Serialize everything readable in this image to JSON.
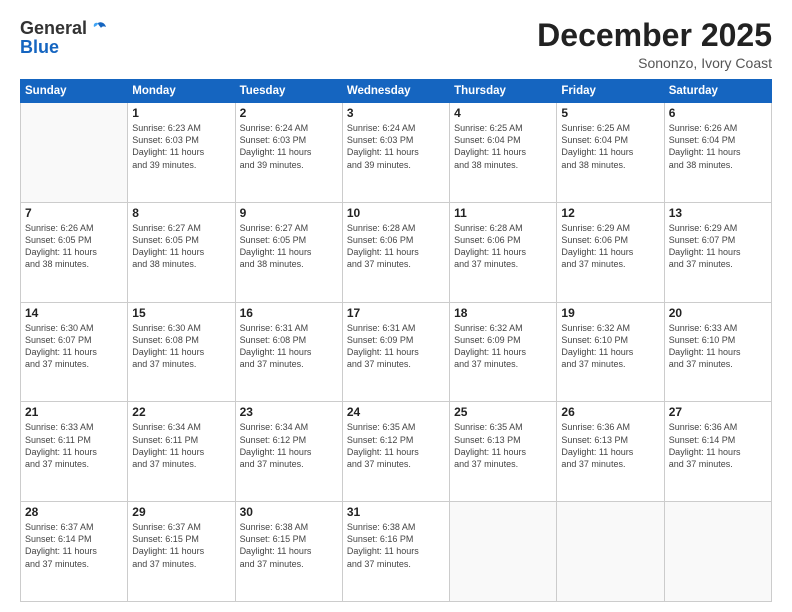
{
  "header": {
    "logo_general": "General",
    "logo_blue": "Blue",
    "month": "December 2025",
    "location": "Sononzo, Ivory Coast"
  },
  "weekdays": [
    "Sunday",
    "Monday",
    "Tuesday",
    "Wednesday",
    "Thursday",
    "Friday",
    "Saturday"
  ],
  "weeks": [
    [
      {
        "day": "",
        "info": ""
      },
      {
        "day": "1",
        "info": "Sunrise: 6:23 AM\nSunset: 6:03 PM\nDaylight: 11 hours\nand 39 minutes."
      },
      {
        "day": "2",
        "info": "Sunrise: 6:24 AM\nSunset: 6:03 PM\nDaylight: 11 hours\nand 39 minutes."
      },
      {
        "day": "3",
        "info": "Sunrise: 6:24 AM\nSunset: 6:03 PM\nDaylight: 11 hours\nand 39 minutes."
      },
      {
        "day": "4",
        "info": "Sunrise: 6:25 AM\nSunset: 6:04 PM\nDaylight: 11 hours\nand 38 minutes."
      },
      {
        "day": "5",
        "info": "Sunrise: 6:25 AM\nSunset: 6:04 PM\nDaylight: 11 hours\nand 38 minutes."
      },
      {
        "day": "6",
        "info": "Sunrise: 6:26 AM\nSunset: 6:04 PM\nDaylight: 11 hours\nand 38 minutes."
      }
    ],
    [
      {
        "day": "7",
        "info": "Sunrise: 6:26 AM\nSunset: 6:05 PM\nDaylight: 11 hours\nand 38 minutes."
      },
      {
        "day": "8",
        "info": "Sunrise: 6:27 AM\nSunset: 6:05 PM\nDaylight: 11 hours\nand 38 minutes."
      },
      {
        "day": "9",
        "info": "Sunrise: 6:27 AM\nSunset: 6:05 PM\nDaylight: 11 hours\nand 38 minutes."
      },
      {
        "day": "10",
        "info": "Sunrise: 6:28 AM\nSunset: 6:06 PM\nDaylight: 11 hours\nand 37 minutes."
      },
      {
        "day": "11",
        "info": "Sunrise: 6:28 AM\nSunset: 6:06 PM\nDaylight: 11 hours\nand 37 minutes."
      },
      {
        "day": "12",
        "info": "Sunrise: 6:29 AM\nSunset: 6:06 PM\nDaylight: 11 hours\nand 37 minutes."
      },
      {
        "day": "13",
        "info": "Sunrise: 6:29 AM\nSunset: 6:07 PM\nDaylight: 11 hours\nand 37 minutes."
      }
    ],
    [
      {
        "day": "14",
        "info": "Sunrise: 6:30 AM\nSunset: 6:07 PM\nDaylight: 11 hours\nand 37 minutes."
      },
      {
        "day": "15",
        "info": "Sunrise: 6:30 AM\nSunset: 6:08 PM\nDaylight: 11 hours\nand 37 minutes."
      },
      {
        "day": "16",
        "info": "Sunrise: 6:31 AM\nSunset: 6:08 PM\nDaylight: 11 hours\nand 37 minutes."
      },
      {
        "day": "17",
        "info": "Sunrise: 6:31 AM\nSunset: 6:09 PM\nDaylight: 11 hours\nand 37 minutes."
      },
      {
        "day": "18",
        "info": "Sunrise: 6:32 AM\nSunset: 6:09 PM\nDaylight: 11 hours\nand 37 minutes."
      },
      {
        "day": "19",
        "info": "Sunrise: 6:32 AM\nSunset: 6:10 PM\nDaylight: 11 hours\nand 37 minutes."
      },
      {
        "day": "20",
        "info": "Sunrise: 6:33 AM\nSunset: 6:10 PM\nDaylight: 11 hours\nand 37 minutes."
      }
    ],
    [
      {
        "day": "21",
        "info": "Sunrise: 6:33 AM\nSunset: 6:11 PM\nDaylight: 11 hours\nand 37 minutes."
      },
      {
        "day": "22",
        "info": "Sunrise: 6:34 AM\nSunset: 6:11 PM\nDaylight: 11 hours\nand 37 minutes."
      },
      {
        "day": "23",
        "info": "Sunrise: 6:34 AM\nSunset: 6:12 PM\nDaylight: 11 hours\nand 37 minutes."
      },
      {
        "day": "24",
        "info": "Sunrise: 6:35 AM\nSunset: 6:12 PM\nDaylight: 11 hours\nand 37 minutes."
      },
      {
        "day": "25",
        "info": "Sunrise: 6:35 AM\nSunset: 6:13 PM\nDaylight: 11 hours\nand 37 minutes."
      },
      {
        "day": "26",
        "info": "Sunrise: 6:36 AM\nSunset: 6:13 PM\nDaylight: 11 hours\nand 37 minutes."
      },
      {
        "day": "27",
        "info": "Sunrise: 6:36 AM\nSunset: 6:14 PM\nDaylight: 11 hours\nand 37 minutes."
      }
    ],
    [
      {
        "day": "28",
        "info": "Sunrise: 6:37 AM\nSunset: 6:14 PM\nDaylight: 11 hours\nand 37 minutes."
      },
      {
        "day": "29",
        "info": "Sunrise: 6:37 AM\nSunset: 6:15 PM\nDaylight: 11 hours\nand 37 minutes."
      },
      {
        "day": "30",
        "info": "Sunrise: 6:38 AM\nSunset: 6:15 PM\nDaylight: 11 hours\nand 37 minutes."
      },
      {
        "day": "31",
        "info": "Sunrise: 6:38 AM\nSunset: 6:16 PM\nDaylight: 11 hours\nand 37 minutes."
      },
      {
        "day": "",
        "info": ""
      },
      {
        "day": "",
        "info": ""
      },
      {
        "day": "",
        "info": ""
      }
    ]
  ]
}
